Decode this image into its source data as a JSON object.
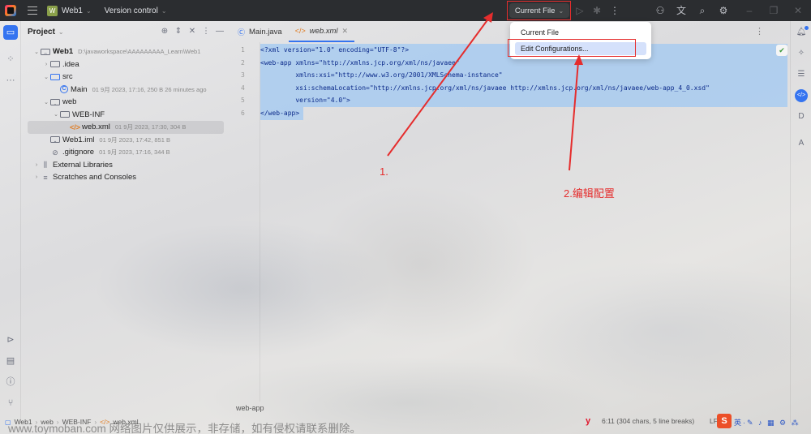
{
  "titlebar": {
    "project": "Web1",
    "project_badge": "W",
    "vcs": "Version control",
    "run_config": "Current File",
    "icons": [
      "run-icon",
      "debug-icon",
      "more-icon",
      "add-user-icon",
      "translate-icon",
      "search-icon",
      "settings-icon",
      "minimize-icon",
      "restore-icon",
      "close-icon"
    ]
  },
  "run_menu": {
    "items": [
      {
        "label": "Current File"
      },
      {
        "label": "Edit Configurations...",
        "highlighted": true
      }
    ]
  },
  "project_panel": {
    "title": "Project",
    "tree": [
      {
        "name": "Web1",
        "meta": "D:\\javaworkspace\\AAAAAAAAA_Learn\\Web1",
        "level": 0,
        "expanded": true,
        "icon": "module-folder"
      },
      {
        "name": ".idea",
        "meta": "",
        "level": 1,
        "expanded": false,
        "icon": "folder"
      },
      {
        "name": "src",
        "meta": "",
        "level": 1,
        "expanded": true,
        "icon": "source-folder"
      },
      {
        "name": "Main",
        "meta": "01 9月 2023, 17:16, 250 B 26 minutes ago",
        "level": 2,
        "icon": "class"
      },
      {
        "name": "web",
        "meta": "",
        "level": 1,
        "expanded": true,
        "icon": "web-folder"
      },
      {
        "name": "WEB-INF",
        "meta": "",
        "level": 2,
        "expanded": true,
        "icon": "folder"
      },
      {
        "name": "web.xml",
        "meta": "01 9月 2023, 17:30, 304 B",
        "level": 3,
        "icon": "xml",
        "selected": true
      },
      {
        "name": "Web1.iml",
        "meta": "01 9月 2023, 17:42, 851 B",
        "level": 1,
        "icon": "iml"
      },
      {
        "name": ".gitignore",
        "meta": "01 9月 2023, 17:16, 344 B",
        "level": 1,
        "icon": "ignore"
      },
      {
        "name": "External Libraries",
        "meta": "",
        "level": 0,
        "expanded": false,
        "icon": "library"
      },
      {
        "name": "Scratches and Consoles",
        "meta": "",
        "level": 0,
        "expanded": false,
        "icon": "scratch"
      }
    ]
  },
  "editor": {
    "tabs": [
      {
        "label": "Main.java",
        "active": false
      },
      {
        "label": "web.xml",
        "active": true
      }
    ],
    "line_numbers": [
      "1",
      "2",
      "3",
      "4",
      "5",
      "6"
    ],
    "lines": [
      "<?xml version=\"1.0\" encoding=\"UTF-8\"?>",
      "<web-app xmlns=\"http://xmlns.jcp.org/xml/ns/javaee\"",
      "         xmlns:xsi=\"http://www.w3.org/2001/XMLSchema-instance\"",
      "         xsi:schemaLocation=\"http://xmlns.jcp.org/xml/ns/javaee http://xmlns.jcp.org/xml/ns/javaee/web-app_4_0.xsd\"",
      "         version=\"4.0\">",
      "</web-app>"
    ],
    "breadcrumb": "web-app"
  },
  "annotations": {
    "step1": "1.",
    "step2": "2.编辑配置",
    "color": "#e52d2d"
  },
  "statusbar": {
    "crumbs": [
      "Web1",
      "web",
      "WEB-INF",
      "web.xml"
    ],
    "position": "6:11 (304 chars, 5 line breaks)",
    "line_ending": "LF",
    "ime_logo": "S",
    "ime_text": "英·✎ ♪ ▦ ⚙ ⁂"
  },
  "watermark": "www.toymoban.com 网络图片仅供展示，非存储，如有侵权请联系删除。"
}
